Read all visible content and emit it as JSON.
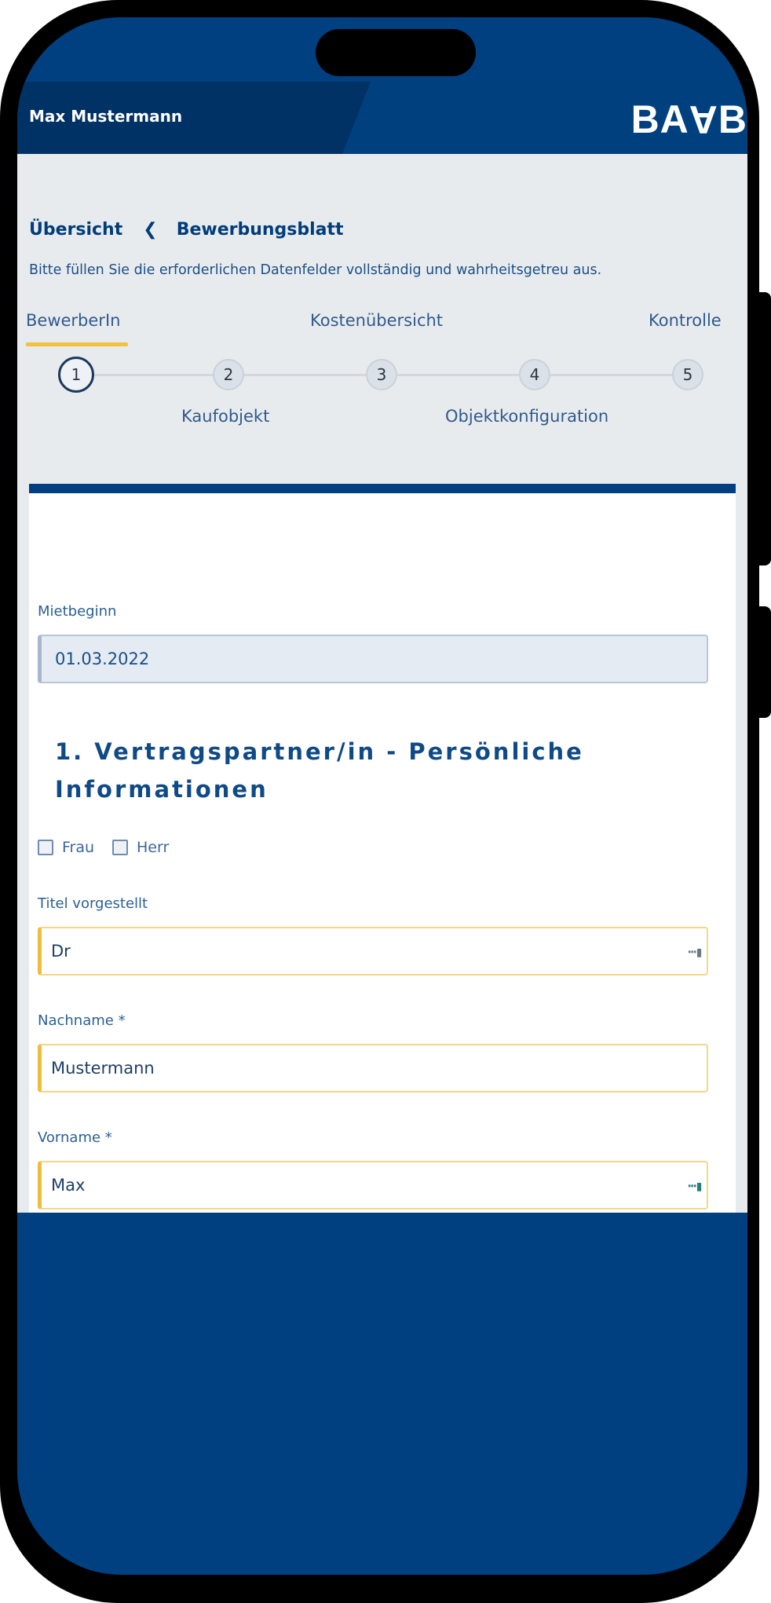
{
  "header": {
    "user_name": "Max Mustermann",
    "logo_left": "BA",
    "logo_flip": "A",
    "logo_right": "B"
  },
  "breadcrumb": {
    "overview": "Übersicht",
    "current": "Bewerbungsblatt"
  },
  "intro_text": "Bitte füllen Sie die erforderlichen Datenfelder vollständig und wahrheitsgetreu aus.",
  "steps": [
    {
      "number": "1",
      "label": "BewerberIn",
      "active": true
    },
    {
      "number": "2",
      "label": "Kaufobjekt"
    },
    {
      "number": "3",
      "label": "Kostenübersicht"
    },
    {
      "number": "4",
      "label": "Objektkonfiguration"
    },
    {
      "number": "5",
      "label": "Kontrolle"
    }
  ],
  "form": {
    "rent_start": {
      "label": "Mietbeginn",
      "value": "01.03.2022"
    },
    "section_title": "1. Vertragspartner/in - Persönliche Informationen",
    "gender_options": [
      "Frau",
      "Herr"
    ],
    "title_prefix": {
      "label": "Titel vorgestellt",
      "value": "Dr"
    },
    "last_name": {
      "label": "Nachname *",
      "value": "Mustermann"
    },
    "first_name": {
      "label": "Vorname *",
      "value": "Max"
    }
  },
  "colors": {
    "brand_blue": "#004080",
    "accent_yellow": "#efbd3e"
  }
}
